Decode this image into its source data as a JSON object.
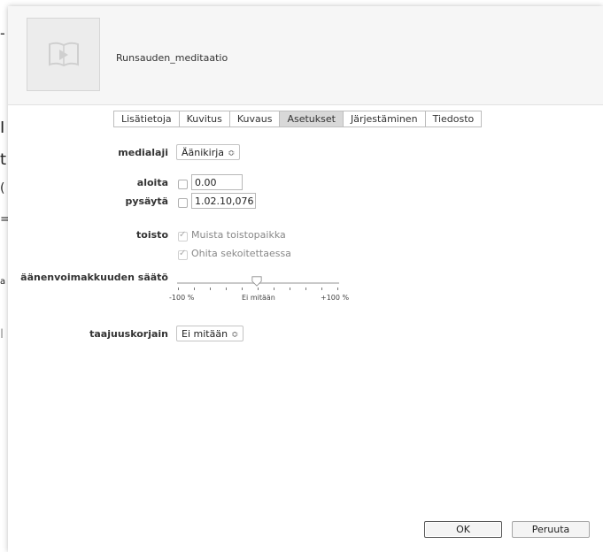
{
  "background_chars": [
    "t",
    "I",
    "t",
    "(",
    "=",
    "a",
    "I"
  ],
  "dialog": {
    "title": "Runsauden_meditaatio",
    "artwork_icon": "audiobook-icon"
  },
  "tabs": [
    {
      "label": "Lisätietoja",
      "active": false
    },
    {
      "label": "Kuvitus",
      "active": false
    },
    {
      "label": "Kuvaus",
      "active": false
    },
    {
      "label": "Asetukset",
      "active": true
    },
    {
      "label": "Järjestäminen",
      "active": false
    },
    {
      "label": "Tiedosto",
      "active": false
    }
  ],
  "settings": {
    "media_kind_label": "medialaji",
    "media_kind_value": "Äänikirja",
    "start_label": "aloita",
    "start_value": "0.00",
    "start_checked": false,
    "stop_label": "pysäytä",
    "stop_value": "1.02.10,076",
    "stop_checked": false,
    "playback_label": "toisto",
    "remember_position": "Muista toistopaikka",
    "remember_checked": true,
    "skip_shuffle": "Ohita sekoitettaessa",
    "skip_checked": true,
    "volume_label": "äänenvoimakkuuden säätö",
    "volume_min": "-100 %",
    "volume_mid": "Ei mitään",
    "volume_max": "+100 %",
    "volume_value_percent": 0,
    "eq_label": "taajuuskorjain",
    "eq_value": "Ei mitään"
  },
  "buttons": {
    "ok": "OK",
    "cancel": "Peruuta"
  }
}
